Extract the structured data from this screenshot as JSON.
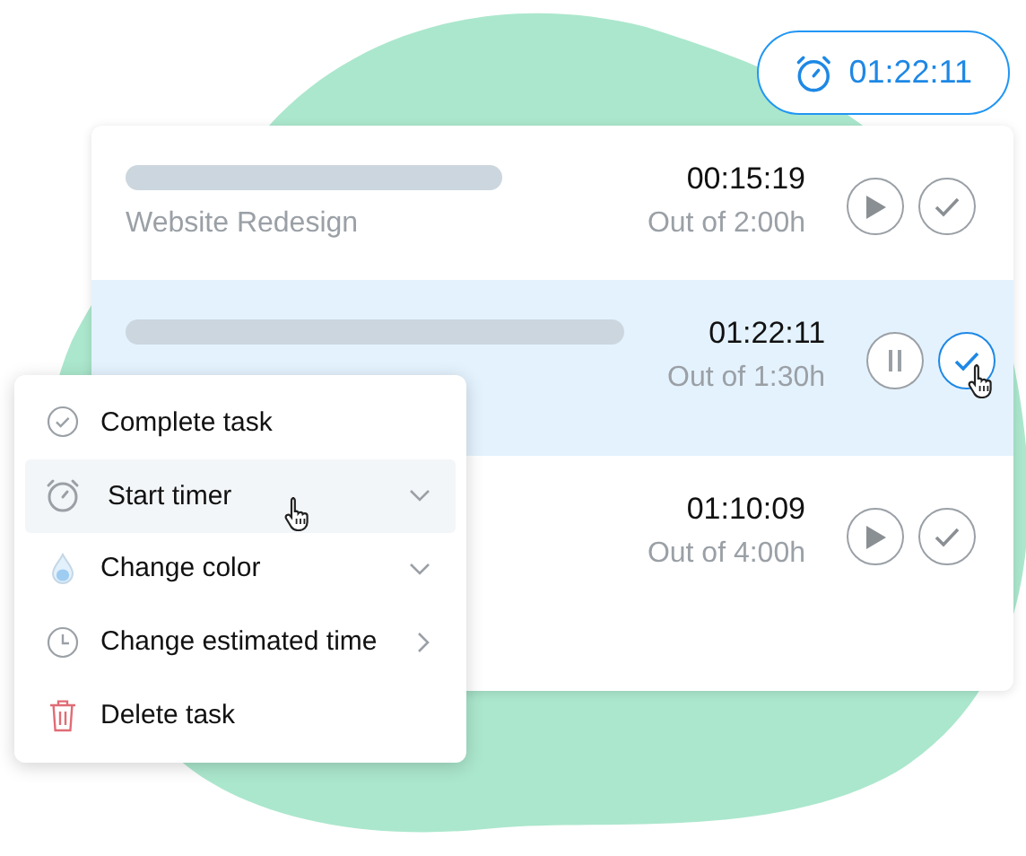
{
  "timer": {
    "time": "01:22:11"
  },
  "tasks": [
    {
      "project": "Website Redesign",
      "time": "00:15:19",
      "estimate": "Out of 2:00h",
      "running": false,
      "selected": false
    },
    {
      "time": "01:22:11",
      "estimate": "Out of 1:30h",
      "running": true,
      "selected": true
    },
    {
      "time": "01:10:09",
      "estimate": "Out of 4:00h",
      "running": false,
      "selected": false
    }
  ],
  "menu": {
    "items": [
      {
        "kind": "complete",
        "label": "Complete task",
        "dropdown": false,
        "submenu": false,
        "selected": false
      },
      {
        "kind": "timer",
        "label": "Start timer",
        "dropdown": true,
        "submenu": false,
        "selected": true
      },
      {
        "kind": "color",
        "label": "Change color",
        "dropdown": true,
        "submenu": false,
        "selected": false
      },
      {
        "kind": "estimate",
        "label": "Change estimated time",
        "dropdown": false,
        "submenu": true,
        "selected": false
      },
      {
        "kind": "delete",
        "label": "Delete task",
        "dropdown": false,
        "submenu": false,
        "selected": false
      }
    ]
  }
}
